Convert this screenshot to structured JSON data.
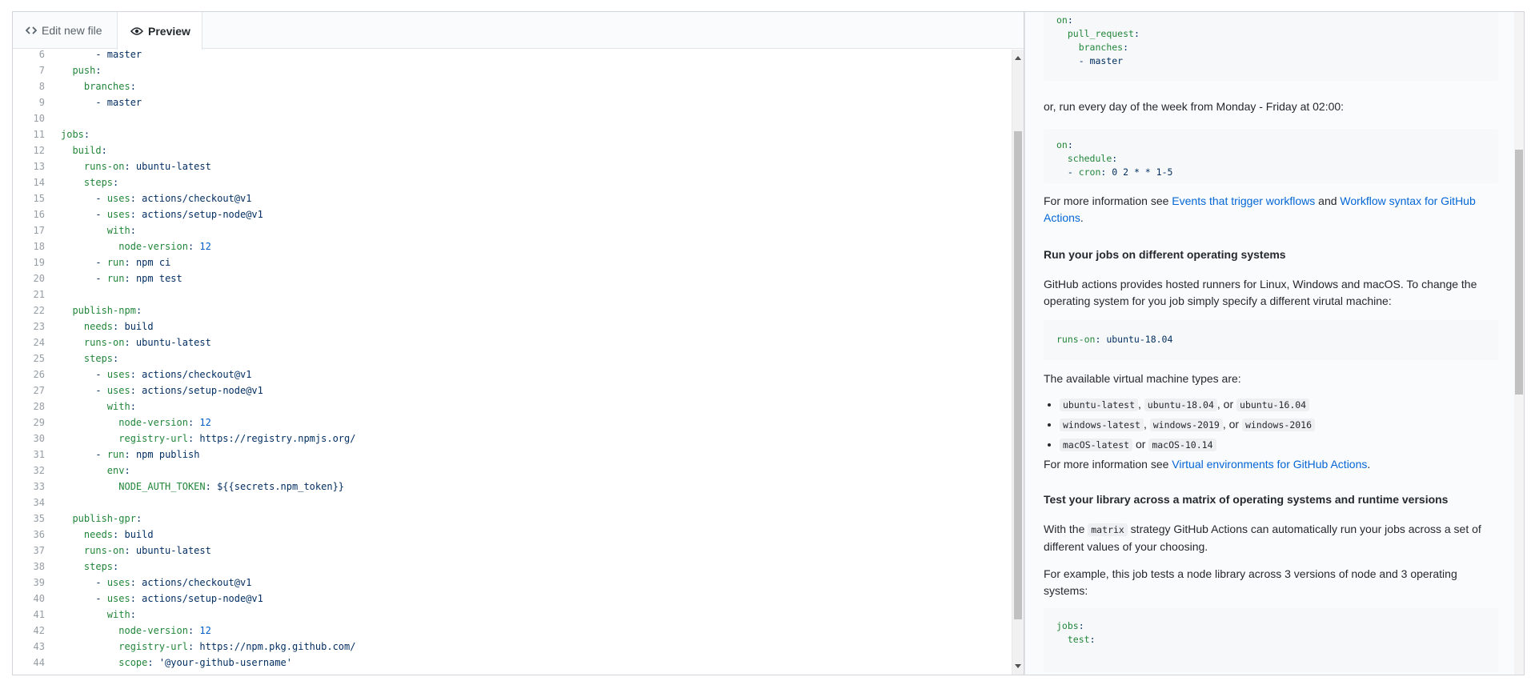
{
  "tabs": {
    "edit_label": "Edit new file",
    "preview_label": "Preview",
    "edit_icon": "code-icon",
    "preview_icon": "eye-icon"
  },
  "editor": {
    "lines": [
      {
        "n": "6",
        "ind": 3,
        "parts": [
          [
            "v",
            "- master"
          ]
        ]
      },
      {
        "n": "7",
        "ind": 1,
        "parts": [
          [
            "k",
            "push"
          ],
          [
            "v",
            ":"
          ]
        ]
      },
      {
        "n": "8",
        "ind": 2,
        "parts": [
          [
            "k",
            "branches"
          ],
          [
            "v",
            ":"
          ]
        ]
      },
      {
        "n": "9",
        "ind": 3,
        "parts": [
          [
            "v",
            "- master"
          ]
        ]
      },
      {
        "n": "10",
        "ind": 0,
        "parts": []
      },
      {
        "n": "11",
        "ind": 0,
        "parts": [
          [
            "k",
            "jobs"
          ],
          [
            "v",
            ":"
          ]
        ]
      },
      {
        "n": "12",
        "ind": 1,
        "parts": [
          [
            "k",
            "build"
          ],
          [
            "v",
            ":"
          ]
        ]
      },
      {
        "n": "13",
        "ind": 2,
        "parts": [
          [
            "k",
            "runs-on"
          ],
          [
            "v",
            ": ubuntu-latest"
          ]
        ]
      },
      {
        "n": "14",
        "ind": 2,
        "parts": [
          [
            "k",
            "steps"
          ],
          [
            "v",
            ":"
          ]
        ]
      },
      {
        "n": "15",
        "ind": 3,
        "parts": [
          [
            "v",
            "- "
          ],
          [
            "k",
            "uses"
          ],
          [
            "v",
            ": actions/checkout@v1"
          ]
        ]
      },
      {
        "n": "16",
        "ind": 3,
        "parts": [
          [
            "v",
            "- "
          ],
          [
            "k",
            "uses"
          ],
          [
            "v",
            ": actions/setup-node@v1"
          ]
        ]
      },
      {
        "n": "17",
        "ind": 4,
        "parts": [
          [
            "k",
            "with"
          ],
          [
            "v",
            ":"
          ]
        ]
      },
      {
        "n": "18",
        "ind": 5,
        "parts": [
          [
            "k",
            "node-version"
          ],
          [
            "v",
            ": "
          ],
          [
            "n",
            "12"
          ]
        ]
      },
      {
        "n": "19",
        "ind": 3,
        "parts": [
          [
            "v",
            "- "
          ],
          [
            "k",
            "run"
          ],
          [
            "v",
            ": npm ci"
          ]
        ]
      },
      {
        "n": "20",
        "ind": 3,
        "parts": [
          [
            "v",
            "- "
          ],
          [
            "k",
            "run"
          ],
          [
            "v",
            ": npm test"
          ]
        ]
      },
      {
        "n": "21",
        "ind": 0,
        "parts": []
      },
      {
        "n": "22",
        "ind": 1,
        "parts": [
          [
            "k",
            "publish-npm"
          ],
          [
            "v",
            ":"
          ]
        ]
      },
      {
        "n": "23",
        "ind": 2,
        "parts": [
          [
            "k",
            "needs"
          ],
          [
            "v",
            ": build"
          ]
        ]
      },
      {
        "n": "24",
        "ind": 2,
        "parts": [
          [
            "k",
            "runs-on"
          ],
          [
            "v",
            ": ubuntu-latest"
          ]
        ]
      },
      {
        "n": "25",
        "ind": 2,
        "parts": [
          [
            "k",
            "steps"
          ],
          [
            "v",
            ":"
          ]
        ]
      },
      {
        "n": "26",
        "ind": 3,
        "parts": [
          [
            "v",
            "- "
          ],
          [
            "k",
            "uses"
          ],
          [
            "v",
            ": actions/checkout@v1"
          ]
        ]
      },
      {
        "n": "27",
        "ind": 3,
        "parts": [
          [
            "v",
            "- "
          ],
          [
            "k",
            "uses"
          ],
          [
            "v",
            ": actions/setup-node@v1"
          ]
        ]
      },
      {
        "n": "28",
        "ind": 4,
        "parts": [
          [
            "k",
            "with"
          ],
          [
            "v",
            ":"
          ]
        ]
      },
      {
        "n": "29",
        "ind": 5,
        "parts": [
          [
            "k",
            "node-version"
          ],
          [
            "v",
            ": "
          ],
          [
            "n",
            "12"
          ]
        ]
      },
      {
        "n": "30",
        "ind": 5,
        "parts": [
          [
            "k",
            "registry-url"
          ],
          [
            "v",
            ": https://registry.npmjs.org/"
          ]
        ]
      },
      {
        "n": "31",
        "ind": 3,
        "parts": [
          [
            "v",
            "- "
          ],
          [
            "k",
            "run"
          ],
          [
            "v",
            ": npm publish"
          ]
        ]
      },
      {
        "n": "32",
        "ind": 4,
        "parts": [
          [
            "k",
            "env"
          ],
          [
            "v",
            ":"
          ]
        ]
      },
      {
        "n": "33",
        "ind": 5,
        "parts": [
          [
            "k",
            "NODE_AUTH_TOKEN"
          ],
          [
            "v",
            ": ${{secrets.npm_token}}"
          ]
        ]
      },
      {
        "n": "34",
        "ind": 0,
        "parts": []
      },
      {
        "n": "35",
        "ind": 1,
        "parts": [
          [
            "k",
            "publish-gpr"
          ],
          [
            "v",
            ":"
          ]
        ]
      },
      {
        "n": "36",
        "ind": 2,
        "parts": [
          [
            "k",
            "needs"
          ],
          [
            "v",
            ": build"
          ]
        ]
      },
      {
        "n": "37",
        "ind": 2,
        "parts": [
          [
            "k",
            "runs-on"
          ],
          [
            "v",
            ": ubuntu-latest"
          ]
        ]
      },
      {
        "n": "38",
        "ind": 2,
        "parts": [
          [
            "k",
            "steps"
          ],
          [
            "v",
            ":"
          ]
        ]
      },
      {
        "n": "39",
        "ind": 3,
        "parts": [
          [
            "v",
            "- "
          ],
          [
            "k",
            "uses"
          ],
          [
            "v",
            ": actions/checkout@v1"
          ]
        ]
      },
      {
        "n": "40",
        "ind": 3,
        "parts": [
          [
            "v",
            "- "
          ],
          [
            "k",
            "uses"
          ],
          [
            "v",
            ": actions/setup-node@v1"
          ]
        ]
      },
      {
        "n": "41",
        "ind": 4,
        "parts": [
          [
            "k",
            "with"
          ],
          [
            "v",
            ":"
          ]
        ]
      },
      {
        "n": "42",
        "ind": 5,
        "parts": [
          [
            "k",
            "node-version"
          ],
          [
            "v",
            ": "
          ],
          [
            "n",
            "12"
          ]
        ]
      },
      {
        "n": "43",
        "ind": 5,
        "parts": [
          [
            "k",
            "registry-url"
          ],
          [
            "v",
            ": https://npm.pkg.github.com/"
          ]
        ]
      },
      {
        "n": "44",
        "ind": 5,
        "parts": [
          [
            "k",
            "scope"
          ],
          [
            "v",
            ": '@your-github-username'"
          ]
        ]
      }
    ]
  },
  "preview": {
    "code1": [
      [
        [
          "k",
          "on"
        ],
        [
          "v",
          ":"
        ]
      ],
      [
        [
          "v",
          "  "
        ],
        [
          "k",
          "pull_request"
        ],
        [
          "v",
          ":"
        ]
      ],
      [
        [
          "v",
          "    "
        ],
        [
          "k",
          "branches"
        ],
        [
          "v",
          ":"
        ]
      ],
      [
        [
          "v",
          "    - master"
        ]
      ]
    ],
    "para_schedule": "or, run every day of the week from Monday - Friday at 02:00:",
    "code2": [
      [
        [
          "k",
          "on"
        ],
        [
          "v",
          ":"
        ]
      ],
      [
        [
          "v",
          "  "
        ],
        [
          "k",
          "schedule"
        ],
        [
          "v",
          ":"
        ]
      ],
      [
        [
          "v",
          "  - "
        ],
        [
          "k",
          "cron"
        ],
        [
          "v",
          ": 0 2 * * 1-5"
        ]
      ]
    ],
    "info1_prefix": "For more information see ",
    "info1_link1": "Events that trigger workflows",
    "info1_mid": " and ",
    "info1_link2": "Workflow syntax for GitHub Actions",
    "info1_suffix": ".",
    "heading_os": "Run your jobs on different operating systems",
    "para_os": "GitHub actions provides hosted runners for Linux, Windows and macOS. To change the operating system for you job simply specify a different virutal machine:",
    "code3": [
      [
        [
          "k",
          "runs-on"
        ],
        [
          "v",
          ": ubuntu-18.04"
        ]
      ]
    ],
    "para_vm": "The available virtual machine types are:",
    "vm_list": [
      {
        "codes": [
          "ubuntu-latest",
          "ubuntu-18.04",
          "ubuntu-16.04"
        ],
        "seps": [
          ", ",
          ", or "
        ]
      },
      {
        "codes": [
          "windows-latest",
          "windows-2019",
          "windows-2016"
        ],
        "seps": [
          ", ",
          ", or "
        ]
      },
      {
        "codes": [
          "macOS-latest",
          "macOS-10.14"
        ],
        "seps": [
          " or "
        ]
      }
    ],
    "info2_prefix": "For more information see ",
    "info2_link": "Virtual environments for GitHub Actions",
    "info2_suffix": ".",
    "heading_matrix": "Test your library across a matrix of operating systems and runtime versions",
    "para_matrix_pre": "With the ",
    "para_matrix_code": "matrix",
    "para_matrix_post": " strategy GitHub Actions can automatically run your jobs across a set of different values of your choosing.",
    "para_example": "For example, this job tests a node library across 3 versions of node and 3 operating systems:",
    "code4": [
      [
        [
          "k",
          "jobs"
        ],
        [
          "v",
          ":"
        ]
      ],
      [
        [
          "v",
          "  "
        ],
        [
          "k",
          "test"
        ],
        [
          "v",
          ":"
        ]
      ]
    ]
  }
}
